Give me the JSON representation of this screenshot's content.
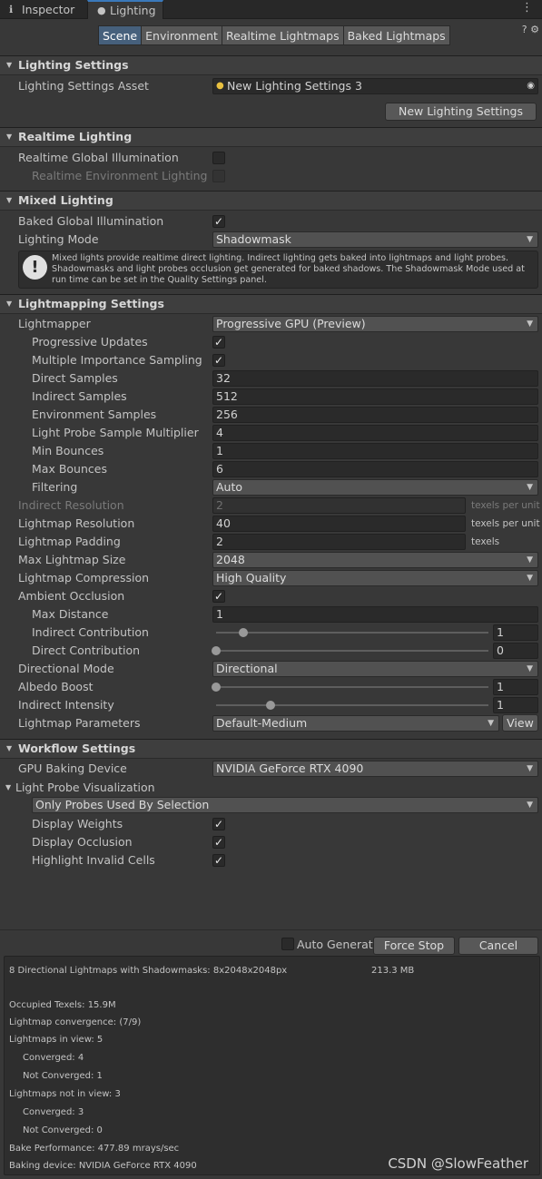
{
  "tabs": {
    "inspector": "Inspector",
    "lighting": "Lighting",
    "inspector_icon": "info-icon",
    "lighting_icon": "bulb-icon",
    "menu": "⋮"
  },
  "modes": [
    "Scene",
    "Environment",
    "Realtime Lightmaps",
    "Baked Lightmaps"
  ],
  "icons": {
    "help": "?",
    "settings": "⚙"
  },
  "lighting_settings": {
    "title": "Lighting Settings",
    "asset_label": "Lighting Settings Asset",
    "asset_value": "New Lighting Settings 3",
    "new_button": "New Lighting Settings"
  },
  "realtime": {
    "title": "Realtime Lighting",
    "rgi_label": "Realtime Global Illumination",
    "rel_label": "Realtime Environment Lighting"
  },
  "mixed": {
    "title": "Mixed Lighting",
    "bgi_label": "Baked Global Illumination",
    "mode_label": "Lighting Mode",
    "mode_value": "Shadowmask",
    "help": "Mixed lights provide realtime direct lighting. Indirect lighting gets baked into lightmaps and light probes. Shadowmasks and light probes occlusion get generated for baked shadows. The Shadowmask Mode used at run time can be set in the Quality Settings panel."
  },
  "lightmapping": {
    "title": "Lightmapping Settings",
    "lightmapper_label": "Lightmapper",
    "lightmapper_value": "Progressive GPU (Preview)",
    "progressive_updates": "Progressive Updates",
    "mis": "Multiple Importance Sampling",
    "direct_samples_label": "Direct Samples",
    "direct_samples": "32",
    "indirect_samples_label": "Indirect Samples",
    "indirect_samples": "512",
    "env_samples_label": "Environment Samples",
    "env_samples": "256",
    "probe_mult_label": "Light Probe Sample Multiplier",
    "probe_mult": "4",
    "min_bounces_label": "Min Bounces",
    "min_bounces": "1",
    "max_bounces_label": "Max Bounces",
    "max_bounces": "6",
    "filtering_label": "Filtering",
    "filtering": "Auto",
    "indirect_res_label": "Indirect Resolution",
    "indirect_res": "2",
    "texels_per_unit": "texels per unit",
    "texels": "texels",
    "lm_res_label": "Lightmap Resolution",
    "lm_res": "40",
    "lm_pad_label": "Lightmap Padding",
    "lm_pad": "2",
    "max_size_label": "Max Lightmap Size",
    "max_size": "2048",
    "compression_label": "Lightmap Compression",
    "compression": "High Quality",
    "ao_label": "Ambient Occlusion",
    "max_dist_label": "Max Distance",
    "max_dist": "1",
    "indirect_contrib_label": "Indirect Contribution",
    "indirect_contrib": "1",
    "direct_contrib_label": "Direct Contribution",
    "direct_contrib": "0",
    "dir_mode_label": "Directional Mode",
    "dir_mode": "Directional",
    "albedo_label": "Albedo Boost",
    "albedo": "1",
    "indirect_int_label": "Indirect Intensity",
    "indirect_int": "1",
    "params_label": "Lightmap Parameters",
    "params": "Default-Medium",
    "view": "View",
    "slider_levels": {
      "indirect_contrib": 0.1,
      "direct_contrib": 0.0,
      "albedo": 0.0,
      "indirect_int": 0.2
    }
  },
  "workflow": {
    "title": "Workflow Settings",
    "gpu_label": "GPU Baking Device",
    "gpu": "NVIDIA GeForce RTX 4090",
    "probe_vis": "Light Probe Visualization",
    "probe_mode": "Only Probes Used By Selection",
    "weights": "Display Weights",
    "occlusion": "Display Occlusion",
    "invalid": "Highlight Invalid Cells"
  },
  "bake": {
    "auto": "Auto Generate",
    "force_stop": "Force Stop",
    "cancel": "Cancel"
  },
  "stats": {
    "line1": "8 Directional Lightmaps with Shadowmasks: 8x2048x2048px",
    "size": "213.3 MB",
    "texels": "Occupied Texels: 15.9M",
    "convergence": "Lightmap convergence: (7/9)",
    "in_view": "Lightmaps in view: 5",
    "conv4": "Converged: 4",
    "notconv1": "Not Converged: 1",
    "not_in_view": "Lightmaps not in view: 3",
    "conv3": "Converged: 3",
    "notconv0": "Not Converged: 0",
    "perf": "Bake Performance: 477.89 mrays/sec",
    "device": "Baking device: NVIDIA GeForce RTX 4090"
  },
  "watermark": "CSDN @SlowFeather"
}
